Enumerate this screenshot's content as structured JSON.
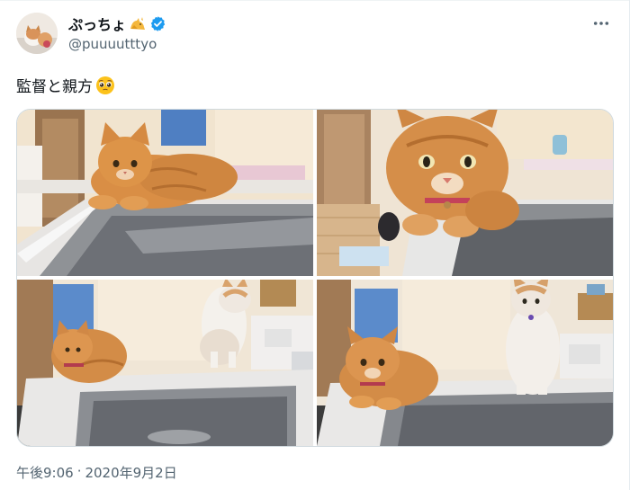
{
  "author": {
    "display_name": "ぷっちょ",
    "name_emoji": "cat-face-emoji",
    "verified_icon": "verified-badge-icon",
    "handle": "@puuuutttyo",
    "verified_color": "#1d9bf0"
  },
  "tweet": {
    "text": "監督と親方",
    "emoji": "pleading-face-emoji"
  },
  "media": {
    "photos": [
      {
        "label": "cat-on-sink-edge-photo"
      },
      {
        "label": "cat-closeup-photo"
      },
      {
        "label": "two-cats-photo"
      },
      {
        "label": "two-cats-sitting-photo"
      }
    ]
  },
  "meta": {
    "time": "午後9:06",
    "separator": "·",
    "date": "2020年9月2日"
  },
  "colors": {
    "text": "#0f1419",
    "secondary": "#536471",
    "border": "#cfd9de"
  }
}
